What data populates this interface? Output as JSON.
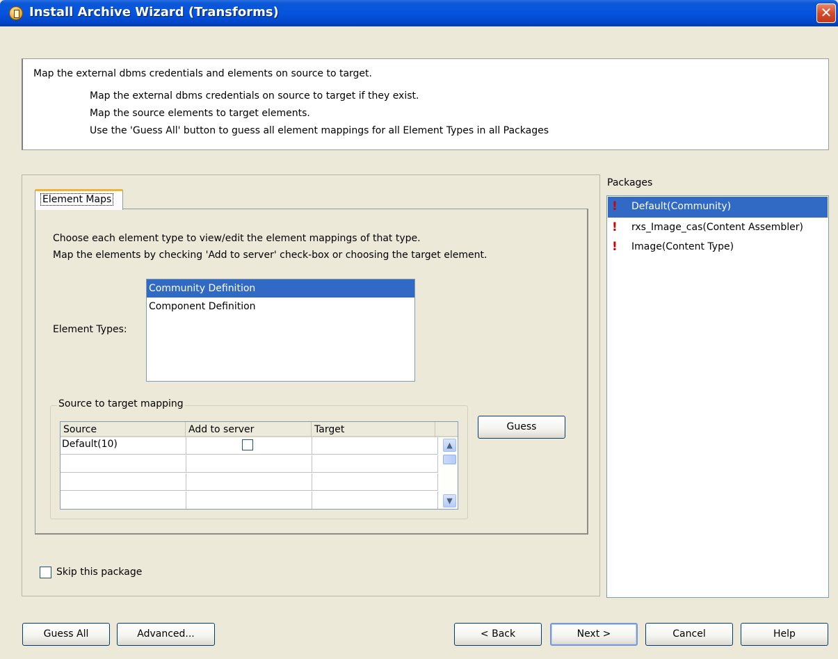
{
  "window": {
    "title": "Install Archive Wizard (Transforms)",
    "close_label": "✕"
  },
  "header": {
    "main": "Map the external dbms credentials and elements on source to target.",
    "lines": [
      "Map the external dbms credentials on source to target if they exist.",
      "Map the source elements to target elements.",
      "Use the 'Guess All' button to guess all element mappings for all Element Types in all Packages"
    ]
  },
  "tab": {
    "label": "Element Maps"
  },
  "instructions": [
    "Choose each element type to view/edit the element mappings of that type.",
    "Map the elements by checking 'Add to server' check-box or choosing the target element."
  ],
  "element_types": {
    "label": "Element Types:",
    "items": [
      "Community Definition",
      "Component Definition"
    ],
    "selected": "Community Definition"
  },
  "mapping": {
    "group_label": "Source to target mapping",
    "columns": [
      "Source",
      "Add to server",
      "Target"
    ],
    "rows": [
      {
        "source": "Default(10)",
        "add_to_server": false,
        "target": ""
      },
      {
        "source": "",
        "add_to_server": null,
        "target": ""
      },
      {
        "source": "",
        "add_to_server": null,
        "target": ""
      },
      {
        "source": "",
        "add_to_server": null,
        "target": ""
      }
    ],
    "guess_label": "Guess"
  },
  "skip": {
    "label": "Skip this package",
    "checked": false
  },
  "packages": {
    "label": "Packages",
    "items": [
      "Default(Community)",
      "rxs_Image_cas(Content Assembler)",
      "Image(Content Type)"
    ],
    "selected": "Default(Community)",
    "status_icon": "warning-exclamation-icon",
    "status_color": "#d40000"
  },
  "footer": {
    "guess_all": "Guess All",
    "advanced": "Advanced...",
    "back": "< Back",
    "next": "Next >",
    "cancel": "Cancel",
    "help": "Help"
  },
  "colors": {
    "titlebar": "#0554e0",
    "selection": "#316ac5",
    "dialog_bg": "#ece9d8"
  }
}
